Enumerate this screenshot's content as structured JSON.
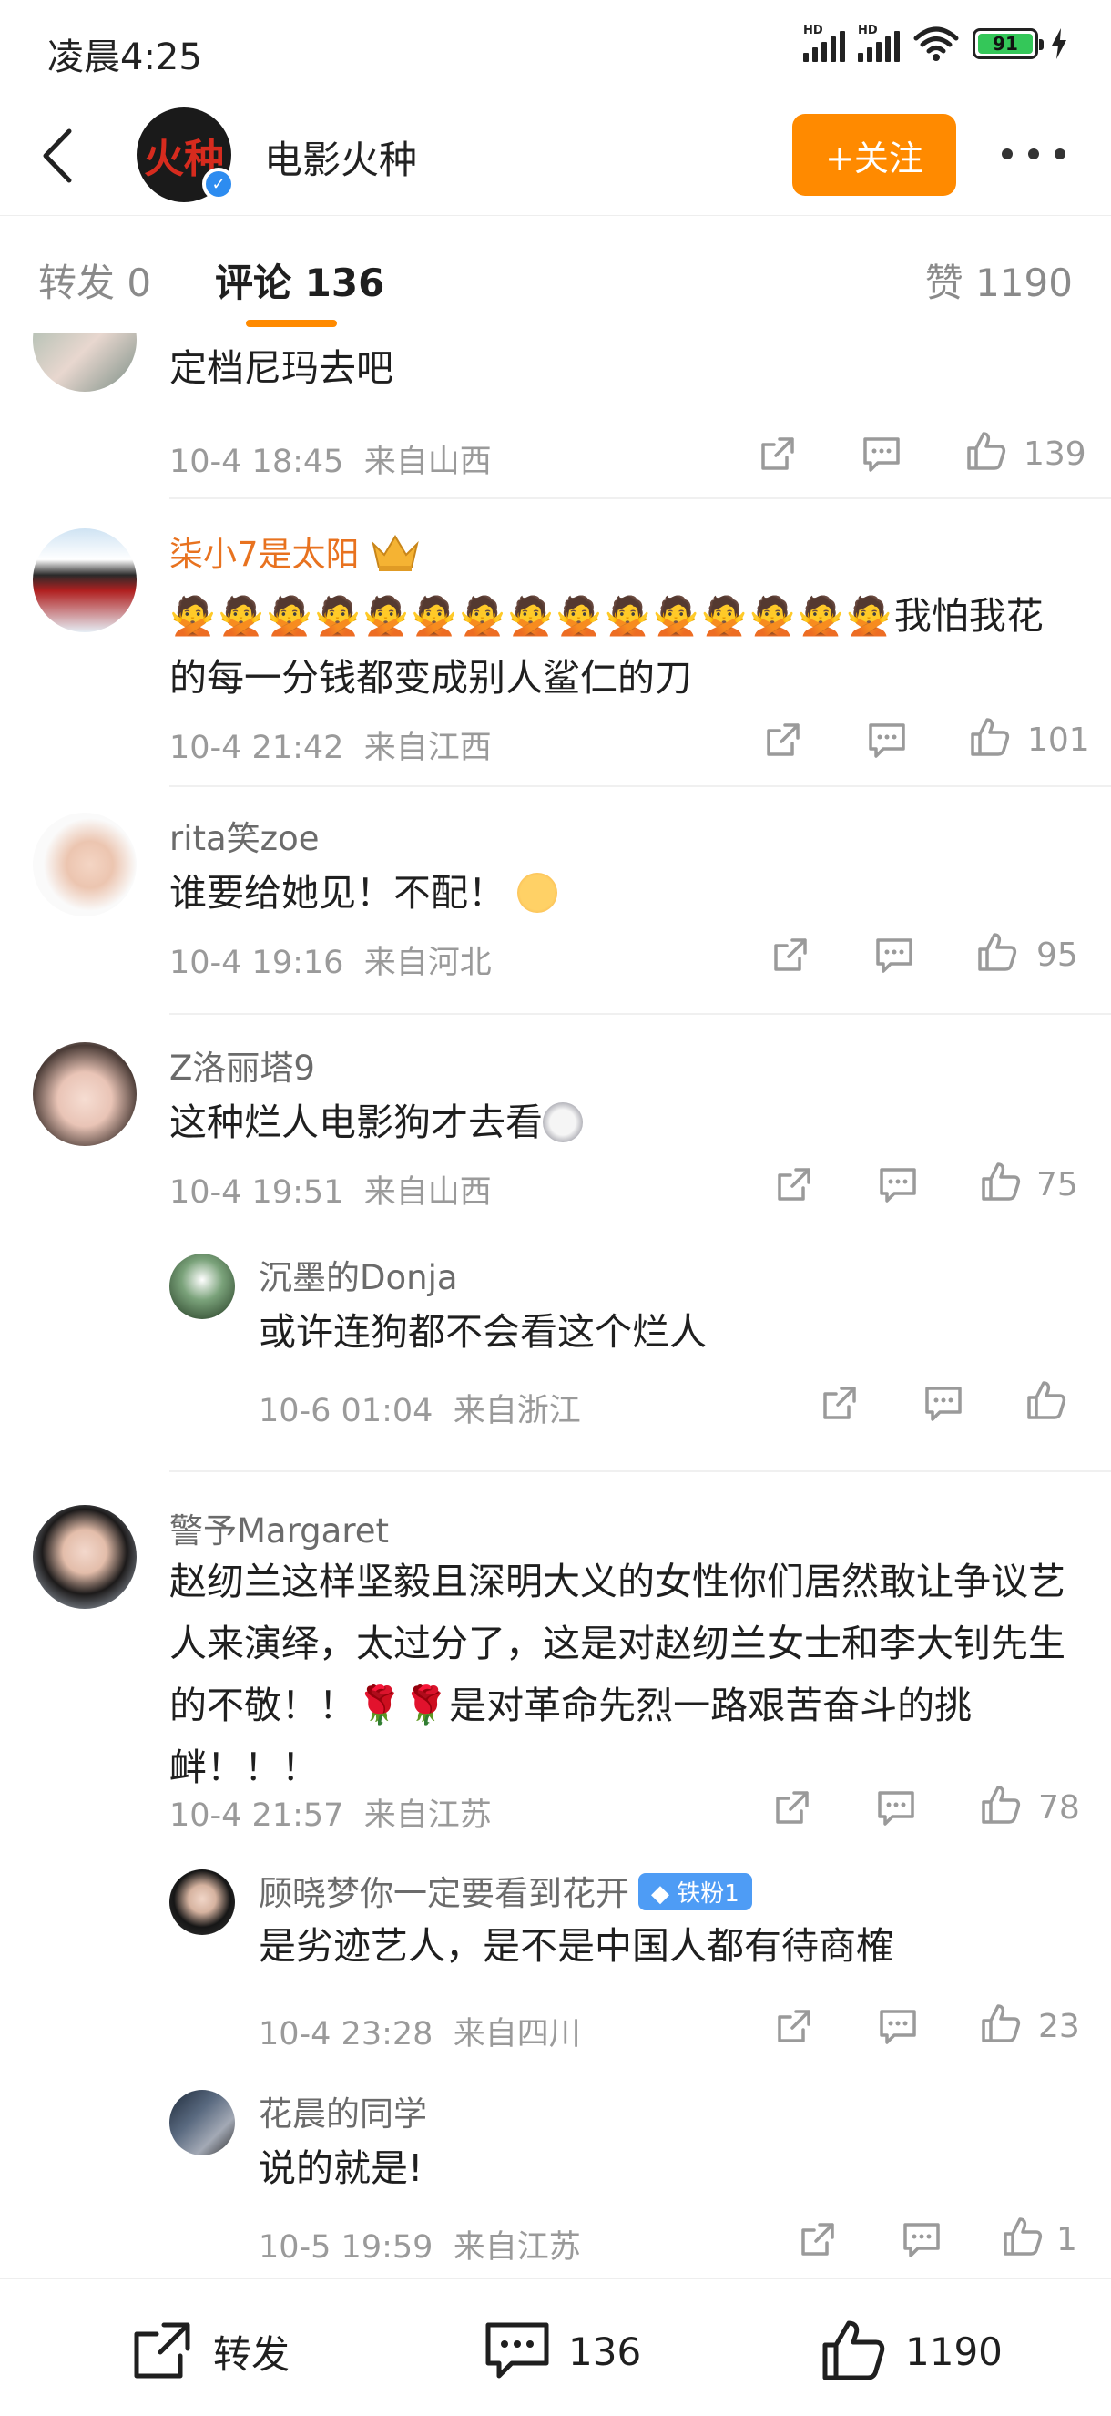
{
  "status_bar": {
    "time": "凌晨4:25",
    "battery": "91",
    "signal_label": "HD"
  },
  "header": {
    "account_name": "电影火种",
    "avatar_text": "火种",
    "follow_label": "+关注"
  },
  "tabs": [
    {
      "label": "转发 0"
    },
    {
      "label": "评论 136"
    },
    {
      "label": "赞 1190"
    }
  ],
  "comments": [
    {
      "text": "定档尼玛去吧",
      "time": "10-4 18:45",
      "location": "来自山西",
      "likes": "139"
    },
    {
      "user": "柒小7是太阳",
      "text": "我怕我花的每一分钱都变成别人鲨仁的刀",
      "time": "10-4 21:42",
      "location": "来自江西",
      "likes": "101"
    },
    {
      "user": "rita笑zoe",
      "text": "谁要给她见！不配！",
      "time": "10-4 19:16",
      "location": "来自河北",
      "likes": "95"
    },
    {
      "user": "Z洛丽塔9",
      "text": "这种烂人电影狗才去看",
      "time": "10-4 19:51",
      "location": "来自山西",
      "likes": "75"
    },
    {
      "user": "警予Margaret",
      "text": "赵纫兰这样坚毅且深明大义的女性你们居然敢让争议艺人来演绎，太过分了，这是对赵纫兰女士和李大钊先生的不敬！！",
      "text_after": "是对革命先烈一路艰苦奋斗的挑衅！！！",
      "time": "10-4 21:57",
      "location": "来自江苏",
      "likes": "78"
    }
  ],
  "replies": [
    {
      "user": "沉墨的Donja",
      "text": "或许连狗都不会看这个烂人",
      "time": "10-6 01:04",
      "location": "来自浙江",
      "likes": ""
    },
    {
      "user": "顾晓梦你一定要看到花开",
      "badge": "铁粉1",
      "text": "是劣迹艺人，是不是中国人都有待商榷",
      "time": "10-4 23:28",
      "location": "来自四川",
      "likes": "23"
    },
    {
      "user": "花晨的同学",
      "text": "说的就是!",
      "time": "10-5 19:59",
      "location": "来自江苏",
      "likes": "1"
    }
  ],
  "bottom_bar": {
    "repost_label": "转发",
    "comment_count": "136",
    "like_count": "1190"
  },
  "colors": {
    "accent": "#ff8a00",
    "vip_name": "#e8721f",
    "badge": "#4e9cf5",
    "verified": "#2d8cf0"
  }
}
